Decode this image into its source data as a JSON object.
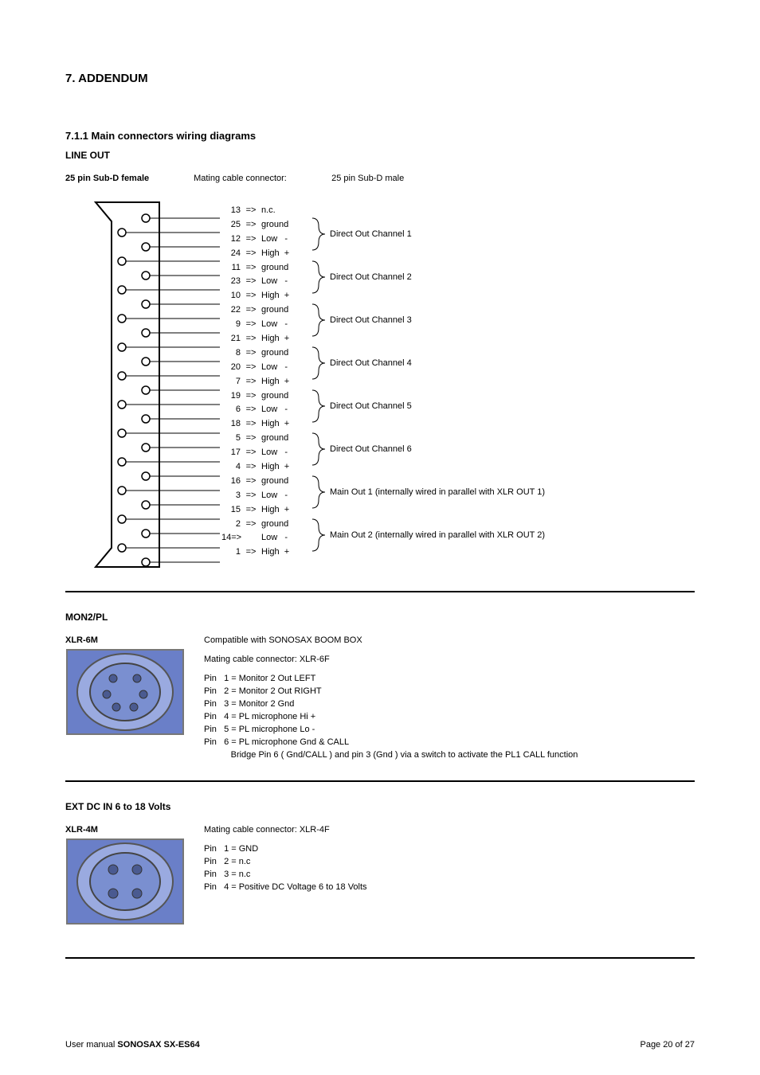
{
  "h1": "7.  ADDENDUM",
  "h2": "7.1.1   Main connectors wiring diagrams",
  "lineout": {
    "title": "LINE OUT",
    "conn_bold": "25 pin Sub-D female",
    "conn_label": "Mating cable connector:",
    "conn_val": "25 pin Sub-D male",
    "pins": [
      {
        "n": "13",
        "s": "n.c."
      },
      {
        "n": "25",
        "s": "ground"
      },
      {
        "n": "12",
        "s": "Low   -"
      },
      {
        "n": "24",
        "s": "High  +"
      },
      {
        "n": "11",
        "s": "ground"
      },
      {
        "n": "23",
        "s": "Low   -"
      },
      {
        "n": "10",
        "s": "High  +"
      },
      {
        "n": "22",
        "s": "ground"
      },
      {
        "n": "9",
        "s": "Low   -"
      },
      {
        "n": "21",
        "s": "High  +"
      },
      {
        "n": "8",
        "s": "ground"
      },
      {
        "n": "20",
        "s": "Low   -"
      },
      {
        "n": "7",
        "s": "High  +"
      },
      {
        "n": "19",
        "s": "ground"
      },
      {
        "n": "6",
        "s": "Low   -"
      },
      {
        "n": "18",
        "s": "High  +"
      },
      {
        "n": "5",
        "s": "ground"
      },
      {
        "n": "17",
        "s": "Low   -"
      },
      {
        "n": "4",
        "s": "High  +"
      },
      {
        "n": "16",
        "s": "ground"
      },
      {
        "n": "3",
        "s": "Low   -"
      },
      {
        "n": "15",
        "s": "High  +"
      },
      {
        "n": "2",
        "s": "ground"
      },
      {
        "n": "14",
        "s": "Low   -",
        "pre": "=>"
      },
      {
        "n": "1",
        "s": "High  +"
      }
    ],
    "channels": [
      "Direct Out Channel 1",
      "Direct Out Channel 2",
      "Direct Out Channel 3",
      "Direct Out Channel 4",
      "Direct Out Channel 5",
      "Direct Out Channel 6",
      "Main Out 1    (internally wired in parallel with XLR OUT 1)",
      "Main Out 2    (internally wired in parallel with XLR OUT 2)"
    ]
  },
  "mon2": {
    "title": "MON2/PL",
    "conn_name": "XLR-6M",
    "top1": "Compatible with SONOSAX BOOM BOX",
    "top2": "Mating cable connector:  XLR-6F",
    "pins": [
      "Pin   1 = Monitor 2 Out LEFT",
      "Pin   2 = Monitor 2 Out RIGHT",
      "Pin   3 = Monitor 2 Gnd",
      "Pin   4 = PL microphone Hi +",
      "Pin   5 = PL microphone Lo -",
      "Pin   6 = PL microphone Gnd & CALL",
      "           Bridge Pin 6 ( Gnd/CALL ) and pin 3 (Gnd ) via a switch to activate the PL1 CALL function"
    ]
  },
  "dc": {
    "title": "EXT DC IN 6 to 18 Volts",
    "conn_name": "XLR-4M",
    "top1": "Mating cable connector:  XLR-4F",
    "pins": [
      "Pin   1 = GND",
      "Pin   2 = n.c",
      "Pin   3 = n.c",
      "Pin   4 = Positive DC Voltage 6 to 18 Volts"
    ]
  },
  "footer": {
    "left_pre": "User manual  ",
    "left_prod": "SONOSAX SX-ES64",
    "right": "Page 20 of 27"
  }
}
